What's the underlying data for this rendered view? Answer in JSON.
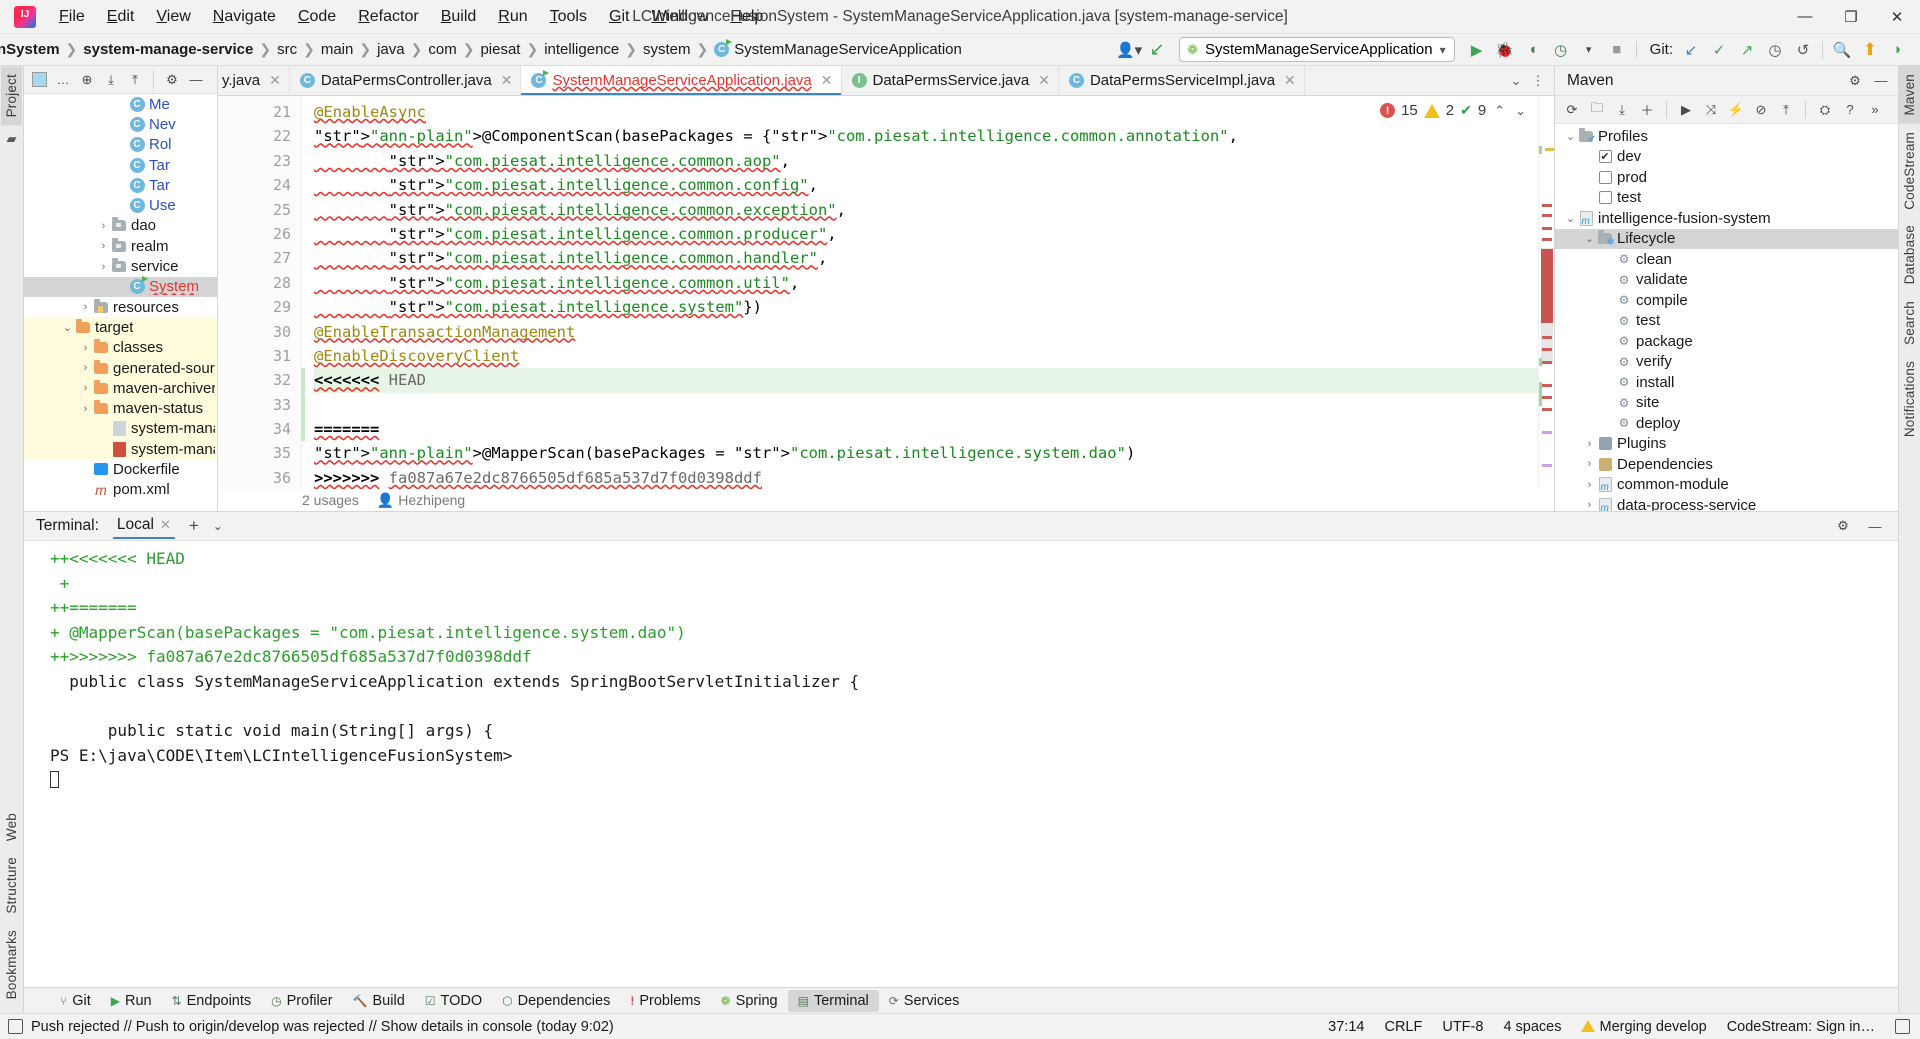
{
  "window": {
    "title": "LCIntelligenceFusionSystem - SystemManageServiceApplication.java [system-manage-service]",
    "minimize": "—",
    "restore": "❐",
    "close": "✕"
  },
  "menu": [
    {
      "label": "File"
    },
    {
      "label": "Edit"
    },
    {
      "label": "View"
    },
    {
      "label": "Navigate"
    },
    {
      "label": "Code"
    },
    {
      "label": "Refactor"
    },
    {
      "label": "Build"
    },
    {
      "label": "Run"
    },
    {
      "label": "Tools"
    },
    {
      "label": "Git"
    },
    {
      "label": "Window"
    },
    {
      "label": "Help"
    }
  ],
  "navbar": {
    "crumbs": [
      {
        "label": "nSystem",
        "style": "bold-clipped"
      },
      {
        "label": "system-manage-service",
        "style": "bold"
      },
      {
        "label": "src",
        "style": "plain"
      },
      {
        "label": "main",
        "style": "plain"
      },
      {
        "label": "java",
        "style": "plain"
      },
      {
        "label": "com",
        "style": "plain"
      },
      {
        "label": "piesat",
        "style": "plain"
      },
      {
        "label": "intelligence",
        "style": "plain"
      },
      {
        "label": "system",
        "style": "plain"
      },
      {
        "label": "SystemManageServiceApplication",
        "style": "class-red"
      }
    ],
    "separator": "❯",
    "avatar_icon": "user-avatar-icon",
    "updates_icon": "vcs-update-icon",
    "run_config": "SystemManageServiceApplication",
    "run_config_caret": "▾",
    "run_icon": "run-icon",
    "debug_icon": "debug-icon",
    "run_coverage_icon": "run-with-coverage-icon",
    "profiler_icon": "profiler-icon",
    "profiler_caret": "▾",
    "stop_icon": "stop-icon",
    "git_label": "Git:",
    "git_update_icon": "git-update-project-icon",
    "git_commit_icon": "git-commit-icon",
    "git_push_icon": "git-push-icon",
    "git_history_icon": "git-history-icon",
    "git_rollback_icon": "git-rollback-icon",
    "search_icon": "search-everywhere-icon",
    "ide_update_icon": "ide-update-icon",
    "more_icon": "more-icon"
  },
  "left_rail": {
    "project_tab": "Project",
    "structure_tab": "Structure",
    "bookmarks_tab": "Bookmarks",
    "git_tab": "Git",
    "web_tab": "Web"
  },
  "right_rail": {
    "maven_tab": "Maven",
    "codestream_tab": "CodeStream",
    "database_tab": "Database",
    "search_tab": "Search",
    "notifications_tab": "Notifications"
  },
  "project_panel": {
    "toolbar": {
      "select_opened_file": "select-opened-file-icon",
      "more_dots": "…",
      "locate_icon": "scroll-from-source-icon",
      "expand_all_icon": "expand-all-icon",
      "collapse_all_icon": "collapse-all-icon",
      "settings_icon": "gear-icon",
      "hide_icon": "hide-panel-icon"
    },
    "tree": [
      {
        "indent": 5,
        "arrow": "",
        "icon": "class",
        "label": "Me",
        "clipped": true,
        "style": "blue"
      },
      {
        "indent": 5,
        "arrow": "",
        "icon": "class",
        "label": "Nev",
        "clipped": true,
        "style": "blue"
      },
      {
        "indent": 5,
        "arrow": "",
        "icon": "class",
        "label": "Rol",
        "clipped": true,
        "style": "blue"
      },
      {
        "indent": 5,
        "arrow": "",
        "icon": "class",
        "label": "Tar",
        "clipped": true,
        "style": "blue"
      },
      {
        "indent": 5,
        "arrow": "",
        "icon": "class",
        "label": "Tar",
        "clipped": true,
        "style": "blue"
      },
      {
        "indent": 5,
        "arrow": "",
        "icon": "class",
        "label": "Use",
        "clipped": true,
        "style": "blue"
      },
      {
        "indent": 4,
        "arrow": "›",
        "icon": "gray-folder",
        "label": "dao",
        "style": "plain"
      },
      {
        "indent": 4,
        "arrow": "›",
        "icon": "gray-folder",
        "label": "realm",
        "style": "plain"
      },
      {
        "indent": 4,
        "arrow": "›",
        "icon": "gray-folder",
        "label": "service",
        "style": "plain"
      },
      {
        "indent": 5,
        "arrow": "",
        "icon": "class-run",
        "label": "System",
        "clipped": true,
        "style": "red-wavy",
        "selected": true
      },
      {
        "indent": 3,
        "arrow": "›",
        "icon": "res-folder",
        "label": "resources",
        "style": "plain"
      },
      {
        "indent": 2,
        "arrow": "⌄",
        "icon": "folder",
        "label": "target",
        "style": "plain",
        "highlight": true
      },
      {
        "indent": 3,
        "arrow": "›",
        "icon": "folder",
        "label": "classes",
        "style": "plain",
        "highlight": true
      },
      {
        "indent": 3,
        "arrow": "›",
        "icon": "folder",
        "label": "generated-sour",
        "clipped": true,
        "style": "plain",
        "highlight": true
      },
      {
        "indent": 3,
        "arrow": "›",
        "icon": "folder",
        "label": "maven-archiver",
        "style": "plain",
        "highlight": true
      },
      {
        "indent": 3,
        "arrow": "›",
        "icon": "folder",
        "label": "maven-status",
        "style": "plain",
        "highlight": true
      },
      {
        "indent": 4,
        "arrow": "",
        "icon": "file",
        "label": "system-manage",
        "clipped": true,
        "style": "plain",
        "highlight": true
      },
      {
        "indent": 4,
        "arrow": "",
        "icon": "file-m",
        "label": "system-manage",
        "clipped": true,
        "style": "plain",
        "highlight": true
      },
      {
        "indent": 3,
        "arrow": "",
        "icon": "docker",
        "label": "Dockerfile",
        "style": "plain"
      },
      {
        "indent": 3,
        "arrow": "",
        "icon": "maven",
        "label": "pom.xml",
        "style": "plain"
      }
    ]
  },
  "editor": {
    "tabs": [
      {
        "label": "y.java",
        "icon": "",
        "clipped": true,
        "active": false,
        "close": "✕"
      },
      {
        "label": "DataPermsController.java",
        "icon": "class",
        "active": false,
        "close": "✕"
      },
      {
        "label": "SystemManageServiceApplication.java",
        "icon": "class-run",
        "active": true,
        "red": true,
        "close": "✕"
      },
      {
        "label": "DataPermsService.java",
        "icon": "interface",
        "active": false,
        "close": "✕"
      },
      {
        "label": "DataPermsServiceImpl.java",
        "icon": "class",
        "active": false,
        "close": "✕"
      }
    ],
    "tab_controls": {
      "dropdown": "⌄",
      "more": "⋮"
    },
    "inspections": {
      "error_count": "15",
      "warning_count": "2",
      "ok_count": "9",
      "prev": "⌃",
      "next": "⌄"
    },
    "lines": [
      {
        "num": "21",
        "type": "annotation",
        "text": "@EnableAsync"
      },
      {
        "num": "22",
        "type": "code",
        "text": "@ComponentScan(basePackages = {\"com.piesat.intelligence.common.annotation\","
      },
      {
        "num": "23",
        "type": "code",
        "text": "        \"com.piesat.intelligence.common.aop\","
      },
      {
        "num": "24",
        "type": "code",
        "text": "        \"com.piesat.intelligence.common.config\","
      },
      {
        "num": "25",
        "type": "code",
        "text": "        \"com.piesat.intelligence.common.exception\","
      },
      {
        "num": "26",
        "type": "code",
        "text": "        \"com.piesat.intelligence.common.producer\","
      },
      {
        "num": "27",
        "type": "code",
        "text": "        \"com.piesat.intelligence.common.handler\","
      },
      {
        "num": "28",
        "type": "code",
        "text": "        \"com.piesat.intelligence.common.util\","
      },
      {
        "num": "29",
        "type": "code",
        "text": "        \"com.piesat.intelligence.system\"})"
      },
      {
        "num": "30",
        "type": "annotation",
        "text": "@EnableTransactionManagement"
      },
      {
        "num": "31",
        "type": "annotation",
        "text": "@EnableDiscoveryClient"
      },
      {
        "num": "32",
        "type": "conflict-head",
        "text": "<<<<<<< HEAD"
      },
      {
        "num": "33",
        "type": "blank",
        "text": ""
      },
      {
        "num": "34",
        "type": "conflict-sep",
        "text": "======="
      },
      {
        "num": "35",
        "type": "code",
        "text": "@MapperScan(basePackages = \"com.piesat.intelligence.system.dao\")"
      },
      {
        "num": "36",
        "type": "conflict-tail",
        "text": ">>>>>>> fa087a67e2dc8766505df685a537d7f0d0398ddf"
      }
    ],
    "usages": "2 usages",
    "author": "Hezhipeng"
  },
  "maven_panel": {
    "title": "Maven",
    "settings_icon": "gear-icon",
    "hide_icon": "hide-panel-icon",
    "toolbar": {
      "reload_icon": "reload-all-maven-projects-icon",
      "add_icon": "add-maven-project-icon",
      "download_icon": "download-sources-icon",
      "plus_icon": "plus-icon",
      "run_icon": "run-maven-goal-icon",
      "skip_tests_icon": "toggle-skip-tests-icon",
      "execute_icon": "execute-maven-goal-icon",
      "offline_icon": "toggle-offline-icon",
      "collapse_icon": "collapse-all-icon",
      "settings_icon": "maven-settings-icon",
      "help_icon": "help-icon",
      "overflow_icon": "»"
    },
    "tree": [
      {
        "indent": 0,
        "arrow": "⌄",
        "icon": "profiles-folder",
        "label": "Profiles"
      },
      {
        "indent": 1,
        "arrow": "",
        "icon": "checkbox-checked",
        "label": "dev"
      },
      {
        "indent": 1,
        "arrow": "",
        "icon": "checkbox",
        "label": "prod"
      },
      {
        "indent": 1,
        "arrow": "",
        "icon": "checkbox",
        "label": "test"
      },
      {
        "indent": 0,
        "arrow": "⌄",
        "icon": "maven-module",
        "label": "intelligence-fusion-system"
      },
      {
        "indent": 1,
        "arrow": "⌄",
        "icon": "lifecycle-folder",
        "label": "Lifecycle",
        "selected": true
      },
      {
        "indent": 2,
        "arrow": "",
        "icon": "goal",
        "label": "clean"
      },
      {
        "indent": 2,
        "arrow": "",
        "icon": "goal",
        "label": "validate"
      },
      {
        "indent": 2,
        "arrow": "",
        "icon": "goal",
        "label": "compile"
      },
      {
        "indent": 2,
        "arrow": "",
        "icon": "goal",
        "label": "test"
      },
      {
        "indent": 2,
        "arrow": "",
        "icon": "goal",
        "label": "package"
      },
      {
        "indent": 2,
        "arrow": "",
        "icon": "goal",
        "label": "verify"
      },
      {
        "indent": 2,
        "arrow": "",
        "icon": "goal",
        "label": "install"
      },
      {
        "indent": 2,
        "arrow": "",
        "icon": "goal",
        "label": "site"
      },
      {
        "indent": 2,
        "arrow": "",
        "icon": "goal",
        "label": "deploy"
      },
      {
        "indent": 1,
        "arrow": "›",
        "icon": "plugins-folder",
        "label": "Plugins"
      },
      {
        "indent": 1,
        "arrow": "›",
        "icon": "deps-folder",
        "label": "Dependencies"
      },
      {
        "indent": 1,
        "arrow": "›",
        "icon": "maven-module",
        "label": "common-module"
      },
      {
        "indent": 1,
        "arrow": "›",
        "icon": "maven-module",
        "label": "data-process-service"
      }
    ]
  },
  "terminal": {
    "label": "Terminal:",
    "tab": "Local",
    "tab_close": "✕",
    "add": "+",
    "dropdown": "⌄",
    "settings_icon": "gear-icon",
    "hide_icon": "hide-panel-icon",
    "lines": [
      {
        "text": "++<<<<<<< HEAD",
        "color": "green"
      },
      {
        "text": " +",
        "color": "green"
      },
      {
        "text": "++=======",
        "color": "green"
      },
      {
        "text": "+ @MapperScan(basePackages = \"com.piesat.intelligence.system.dao\")",
        "color": "green"
      },
      {
        "text": "++>>>>>>> fa087a67e2dc8766505df685a537d7f0d0398ddf",
        "color": "green"
      },
      {
        "text": "  public class SystemManageServiceApplication extends SpringBootServletInitializer {",
        "color": "black"
      },
      {
        "text": "",
        "color": "black"
      },
      {
        "text": "      public static void main(String[] args) {",
        "color": "black"
      },
      {
        "text": "PS E:\\java\\CODE\\Item\\LCIntelligenceFusionSystem>",
        "color": "black"
      }
    ]
  },
  "bottom_tools": [
    {
      "label": "Git",
      "icon": "git-icon",
      "active": false
    },
    {
      "label": "Run",
      "icon": "run-icon",
      "active": false
    },
    {
      "label": "Endpoints",
      "icon": "endpoints-icon",
      "active": false
    },
    {
      "label": "Profiler",
      "icon": "profiler-icon",
      "active": false
    },
    {
      "label": "Build",
      "icon": "build-icon",
      "active": false
    },
    {
      "label": "TODO",
      "icon": "todo-icon",
      "active": false
    },
    {
      "label": "Dependencies",
      "icon": "dependencies-icon",
      "active": false
    },
    {
      "label": "Problems",
      "icon": "problems-icon",
      "active": false
    },
    {
      "label": "Spring",
      "icon": "spring-icon",
      "active": false
    },
    {
      "label": "Terminal",
      "icon": "terminal-icon",
      "active": true
    },
    {
      "label": "Services",
      "icon": "services-icon",
      "active": false
    }
  ],
  "statusbar": {
    "message": "Push rejected // Push to origin/develop was rejected // Show details in console (today 9:02)",
    "caret": "37:14",
    "line_separator": "CRLF",
    "encoding": "UTF-8",
    "indent": "4 spaces",
    "branch": "Merging develop",
    "codestream": "CodeStream:  Sign in…",
    "left_icon": "event-log-icon",
    "lock_icon": "read-only-toggle-icon"
  },
  "colors": {
    "accent": "#3f84c7",
    "error": "#e8322b",
    "string": "#1a8a20",
    "annotation": "#9e880d",
    "terminal_green": "#2aa02a",
    "folder": "#f0a05a",
    "highlight": "#fffbdd"
  }
}
